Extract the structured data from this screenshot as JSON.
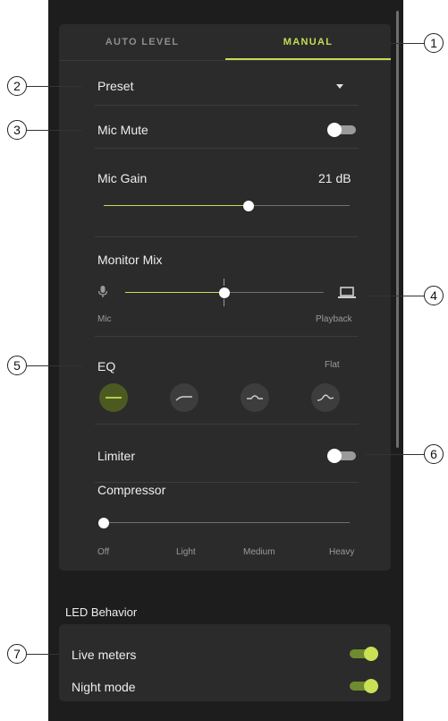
{
  "tabs": {
    "auto_level": "AUTO LEVEL",
    "manual": "MANUAL",
    "active": "manual"
  },
  "preset": {
    "label": "Preset",
    "icon": "caret-down-icon"
  },
  "mic_mute": {
    "label": "Mic Mute",
    "on": false
  },
  "mic_gain": {
    "label": "Mic Gain",
    "value": "21 dB",
    "level": 0.59
  },
  "monitor_mix": {
    "label": "Monitor Mix",
    "left_label": "Mic",
    "right_label": "Playback",
    "level": 0.5,
    "left_icon": "microphone-icon",
    "right_icon": "laptop-icon"
  },
  "eq": {
    "label": "EQ",
    "selected_name": "Flat",
    "options": [
      "flat",
      "low-cut",
      "mid-boost",
      "presence"
    ],
    "selected": 0
  },
  "limiter": {
    "label": "Limiter",
    "on": false
  },
  "compressor": {
    "label": "Compressor",
    "level": 0,
    "stops": [
      "Off",
      "Light",
      "Medium",
      "Heavy"
    ]
  },
  "led": {
    "title": "LED Behavior",
    "live_meters": {
      "label": "Live meters",
      "on": true
    },
    "night_mode": {
      "label": "Night mode",
      "on": true
    }
  },
  "callouts": [
    "1",
    "2",
    "3",
    "4",
    "5",
    "6",
    "7"
  ],
  "colors": {
    "accent": "#c2de54",
    "panel": "#2b2b2b",
    "background": "#1d1d1d"
  }
}
